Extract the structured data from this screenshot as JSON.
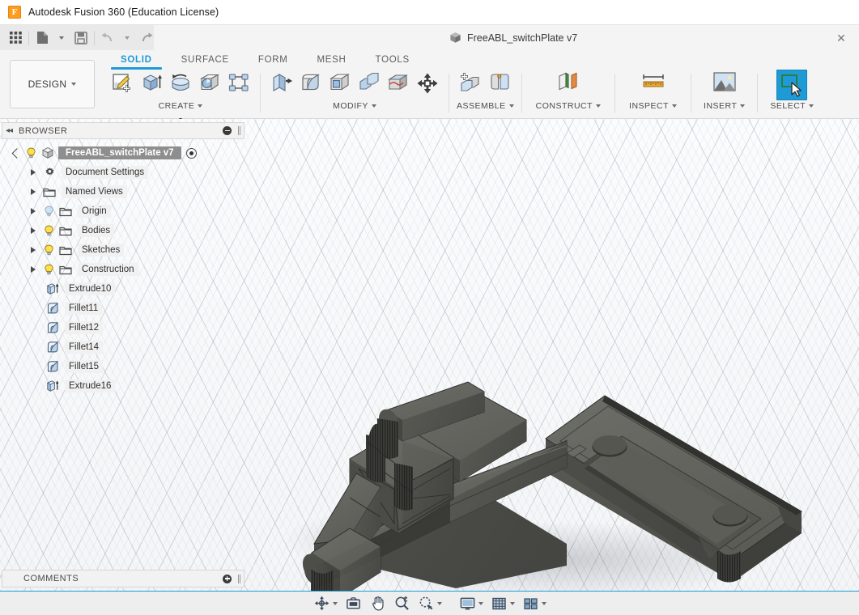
{
  "window": {
    "title": "Autodesk Fusion 360 (Education License)",
    "logo_letter": "F",
    "logo_color": "#ff9c1a"
  },
  "quick_access": {
    "items": [
      {
        "name": "app-grid-icon",
        "label": ""
      },
      {
        "name": "new-file-icon",
        "label": ""
      },
      {
        "name": "save-icon",
        "label": ""
      },
      {
        "name": "undo-icon",
        "label": ""
      },
      {
        "name": "redo-icon",
        "label": ""
      }
    ]
  },
  "document_tab": {
    "label": "FreeABL_switchPlate v7",
    "close_label": "✕"
  },
  "ribbon": {
    "workspace": {
      "label": "DESIGN"
    },
    "tabs": [
      {
        "label": "SOLID",
        "active": true
      },
      {
        "label": "SURFACE",
        "active": false
      },
      {
        "label": "FORM",
        "active": false
      },
      {
        "label": "MESH",
        "active": false
      },
      {
        "label": "TOOLS",
        "active": false
      }
    ],
    "panels": [
      {
        "label": "CREATE",
        "has_dropdown": true,
        "icons": [
          "create-sketch-icon",
          "extrude-icon",
          "revolve-icon",
          "hole-icon",
          "pattern-icon"
        ]
      },
      {
        "label": "MODIFY",
        "has_dropdown": true,
        "icons": [
          "press-pull-icon",
          "fillet-icon",
          "shell-icon",
          "combine-icon",
          "split-face-icon",
          "move-copy-icon"
        ]
      },
      {
        "label": "ASSEMBLE",
        "has_dropdown": true,
        "icons": [
          "new-component-icon",
          "joint-icon"
        ]
      },
      {
        "label": "CONSTRUCT",
        "has_dropdown": true,
        "icons": [
          "offset-plane-icon"
        ]
      },
      {
        "label": "INSPECT",
        "has_dropdown": true,
        "icons": [
          "measure-icon"
        ]
      },
      {
        "label": "INSERT",
        "has_dropdown": true,
        "icons": [
          "insert-image-icon"
        ]
      },
      {
        "label": "SELECT",
        "has_dropdown": true,
        "selected": true,
        "icons": [
          "select-window-icon"
        ]
      }
    ]
  },
  "browser": {
    "title": "BROWSER",
    "collapse_icon": "◂◂",
    "minimize_icon": "minus-circle-icon",
    "root": {
      "label": "FreeABL_switchPlate v7",
      "visible": true,
      "selected": true
    },
    "items": [
      {
        "label": "Document Settings",
        "icon": "gear-icon",
        "has_twisty": true,
        "bulb": "none"
      },
      {
        "label": "Named Views",
        "icon": "folder-icon",
        "has_twisty": true,
        "bulb": "none"
      },
      {
        "label": "Origin",
        "icon": "folder-icon",
        "has_twisty": true,
        "bulb": "off"
      },
      {
        "label": "Bodies",
        "icon": "folder-icon",
        "has_twisty": true,
        "bulb": "on"
      },
      {
        "label": "Sketches",
        "icon": "folder-icon",
        "has_twisty": true,
        "bulb": "on"
      },
      {
        "label": "Construction",
        "icon": "folder-icon",
        "has_twisty": true,
        "bulb": "on"
      },
      {
        "label": "Extrude10",
        "icon": "extrude-feature-icon",
        "has_twisty": false,
        "bulb": "none"
      },
      {
        "label": "Fillet11",
        "icon": "fillet-feature-icon",
        "has_twisty": false,
        "bulb": "none"
      },
      {
        "label": "Fillet12",
        "icon": "fillet-feature-icon",
        "has_twisty": false,
        "bulb": "none"
      },
      {
        "label": "Fillet14",
        "icon": "fillet-feature-icon",
        "has_twisty": false,
        "bulb": "none"
      },
      {
        "label": "Fillet15",
        "icon": "fillet-feature-icon",
        "has_twisty": false,
        "bulb": "none"
      },
      {
        "label": "Extrude16",
        "icon": "extrude-feature-icon",
        "has_twisty": false,
        "bulb": "none"
      }
    ]
  },
  "comments": {
    "title": "COMMENTS",
    "add_icon": "plus-circle-icon"
  },
  "navbar": {
    "items": [
      {
        "name": "orbit-icon",
        "dropdown": true
      },
      {
        "name": "look-at-icon",
        "dropdown": false
      },
      {
        "name": "pan-icon",
        "dropdown": false
      },
      {
        "name": "zoom-icon",
        "dropdown": false
      },
      {
        "name": "fit-icon",
        "dropdown": true
      },
      {
        "name": "display-settings-icon",
        "dropdown": true
      },
      {
        "name": "grid-snaps-icon",
        "dropdown": true
      },
      {
        "name": "viewports-icon",
        "dropdown": true
      }
    ]
  },
  "viewport": {
    "model_name": "switch-plate-body",
    "model_color": "#5a5a57",
    "background": "#f7f9fa",
    "grid": "isometric"
  }
}
